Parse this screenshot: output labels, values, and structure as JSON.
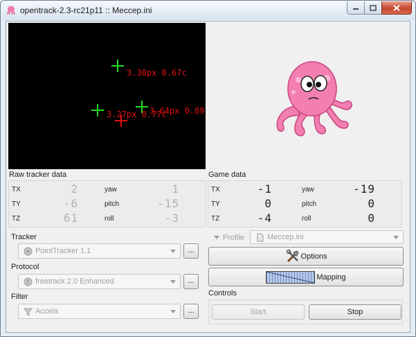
{
  "window": {
    "title": "opentrack-2.3-rc21p11 :: Meccep.ini"
  },
  "video": {
    "labels": [
      "3.30px 0.67c",
      "3.27px 0.77c",
      "3.64px 0.89"
    ]
  },
  "raw_tracker": {
    "title": "Raw tracker data",
    "rows": [
      {
        "l1": "TX",
        "v1": "2",
        "l2": "yaw",
        "v2": "1"
      },
      {
        "l1": "TY",
        "v1": "-6",
        "l2": "pitch",
        "v2": "-15"
      },
      {
        "l1": "TZ",
        "v1": "61",
        "l2": "roll",
        "v2": "-3"
      }
    ]
  },
  "game_data": {
    "title": "Game data",
    "rows": [
      {
        "l1": "TX",
        "v1": "-1",
        "l2": "yaw",
        "v2": "-19"
      },
      {
        "l1": "TY",
        "v1": "0",
        "l2": "pitch",
        "v2": "0"
      },
      {
        "l1": "TZ",
        "v1": "-4",
        "l2": "roll",
        "v2": "0"
      }
    ]
  },
  "tracker": {
    "title": "Tracker",
    "value": "PointTracker 1.1",
    "dots": "..."
  },
  "protocol": {
    "title": "Protocol",
    "value": "freetrack 2.0 Enhanced",
    "dots": "..."
  },
  "filter": {
    "title": "Filter",
    "value": "Accela",
    "dots": "..."
  },
  "profile": {
    "label": "Profile",
    "value": "Meccep.ini"
  },
  "buttons": {
    "options": "Options",
    "mapping": "Mapping"
  },
  "controls": {
    "title": "Controls",
    "start": "Start",
    "stop": "Stop"
  },
  "colors": {
    "lcd_dim": "#b3b3b3",
    "lcd_dark": "#222222",
    "video_green": "#22dd22",
    "video_red": "#e01010"
  }
}
